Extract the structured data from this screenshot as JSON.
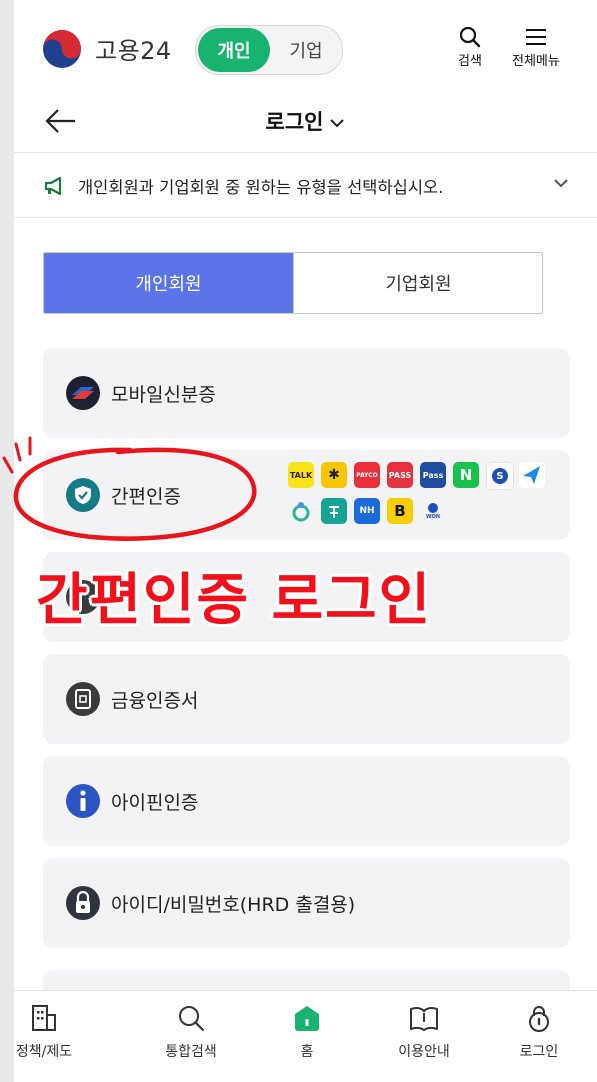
{
  "header": {
    "brand": "고용24",
    "toggle_active": "개인",
    "toggle_inactive": "기업",
    "search_label": "검색",
    "menu_label": "전체메뉴"
  },
  "subheader": {
    "title": "로그인"
  },
  "notice": {
    "text": "개인회원과 기업회원 중 원하는 유형을 선택하십시오."
  },
  "member_tabs": {
    "personal": "개인회원",
    "corporate": "기업회원"
  },
  "login_options": [
    {
      "label": "모바일신분증",
      "icon": "mobile-id-icon"
    },
    {
      "label": "간편인증",
      "icon": "shield-check-icon"
    },
    {
      "label": "",
      "icon": "joint-cert-icon"
    },
    {
      "label": "금융인증서",
      "icon": "financial-cert-icon"
    },
    {
      "label": "아이핀인증",
      "icon": "info-icon"
    },
    {
      "label": "아이디/비밀번호(HRD 출결용)",
      "icon": "lock-icon"
    }
  ],
  "providers": [
    {
      "name": "TALK",
      "color": "#f7e317",
      "text_color": "#3a1d1d"
    },
    {
      "name": "✱",
      "color": "#f7c600",
      "text_color": "#222222"
    },
    {
      "name": "PAYCO",
      "color": "#e8303a",
      "text_color": "#ffffff"
    },
    {
      "name": "PASS",
      "color": "#e5313e",
      "text_color": "#ffffff"
    },
    {
      "name": "Pass",
      "color": "#1e4ea0",
      "text_color": "#ffffff"
    },
    {
      "name": "N",
      "color": "#19c24b",
      "text_color": "#ffffff"
    },
    {
      "name": "S",
      "color": "#ffffff",
      "text_color": "#1e50b3"
    },
    {
      "name": "",
      "color": "#ffffff",
      "text_color": "#1d8af0"
    },
    {
      "name": "",
      "color": "#ffffff",
      "text_color": "#2bb39b"
    },
    {
      "name": "",
      "color": "#16a595",
      "text_color": "#ffffff"
    },
    {
      "name": "NH",
      "color": "#1a6ad8",
      "text_color": "#ffffff"
    },
    {
      "name": "B",
      "color": "#f7ce00",
      "text_color": "#111111"
    },
    {
      "name": "WON",
      "color": "#ffffff",
      "text_color": "#1e4ec7"
    }
  ],
  "annotation": {
    "caption": "간편인증 로그인",
    "color": "#f2101a"
  },
  "bottom_nav": [
    {
      "label": "정책/제도",
      "icon": "building-icon"
    },
    {
      "label": "통합검색",
      "icon": "search-icon"
    },
    {
      "label": "홈",
      "icon": "home-icon"
    },
    {
      "label": "이용안내",
      "icon": "book-icon"
    },
    {
      "label": "로그인",
      "icon": "lock-icon"
    }
  ],
  "colors": {
    "accent_green": "#17b36f",
    "tab_blue": "#5b74e8"
  }
}
